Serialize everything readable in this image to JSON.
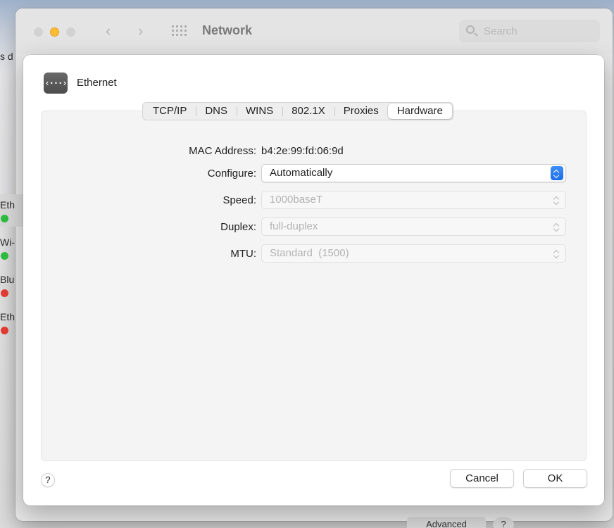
{
  "window": {
    "title": "Network",
    "search_placeholder": "Search"
  },
  "sidebar_fragments": {
    "top_text": "s d",
    "items": [
      {
        "label": "Eth",
        "status": "green"
      },
      {
        "label": "Wi-",
        "status": "green"
      },
      {
        "label": "Blu",
        "status": "red"
      },
      {
        "label": "Eth",
        "status": "red"
      }
    ]
  },
  "bottom_fragments": {
    "advanced_label": "Advanced",
    "help_label": "?"
  },
  "sheet": {
    "interface_icon_glyph": "‹···›",
    "interface_name": "Ethernet",
    "tabs": [
      {
        "label": "TCP/IP",
        "active": false
      },
      {
        "label": "DNS",
        "active": false
      },
      {
        "label": "WINS",
        "active": false
      },
      {
        "label": "802.1X",
        "active": false
      },
      {
        "label": "Proxies",
        "active": false
      },
      {
        "label": "Hardware",
        "active": true
      }
    ],
    "hardware": {
      "mac_label": "MAC Address:",
      "mac_value": "b4:2e:99:fd:06:9d",
      "configure_label": "Configure:",
      "configure_value": "Automatically",
      "speed_label": "Speed:",
      "speed_value": "1000baseT",
      "duplex_label": "Duplex:",
      "duplex_value": "full-duplex",
      "mtu_label": "MTU:",
      "mtu_value": "Standard  (1500)"
    },
    "help_button": "?",
    "cancel_button": "Cancel",
    "ok_button": "OK"
  },
  "colors": {
    "accent": "#1b6ee8",
    "status_green": "#2ebd3f",
    "status_red": "#e33c33",
    "minimize_yellow": "#febc2e"
  }
}
